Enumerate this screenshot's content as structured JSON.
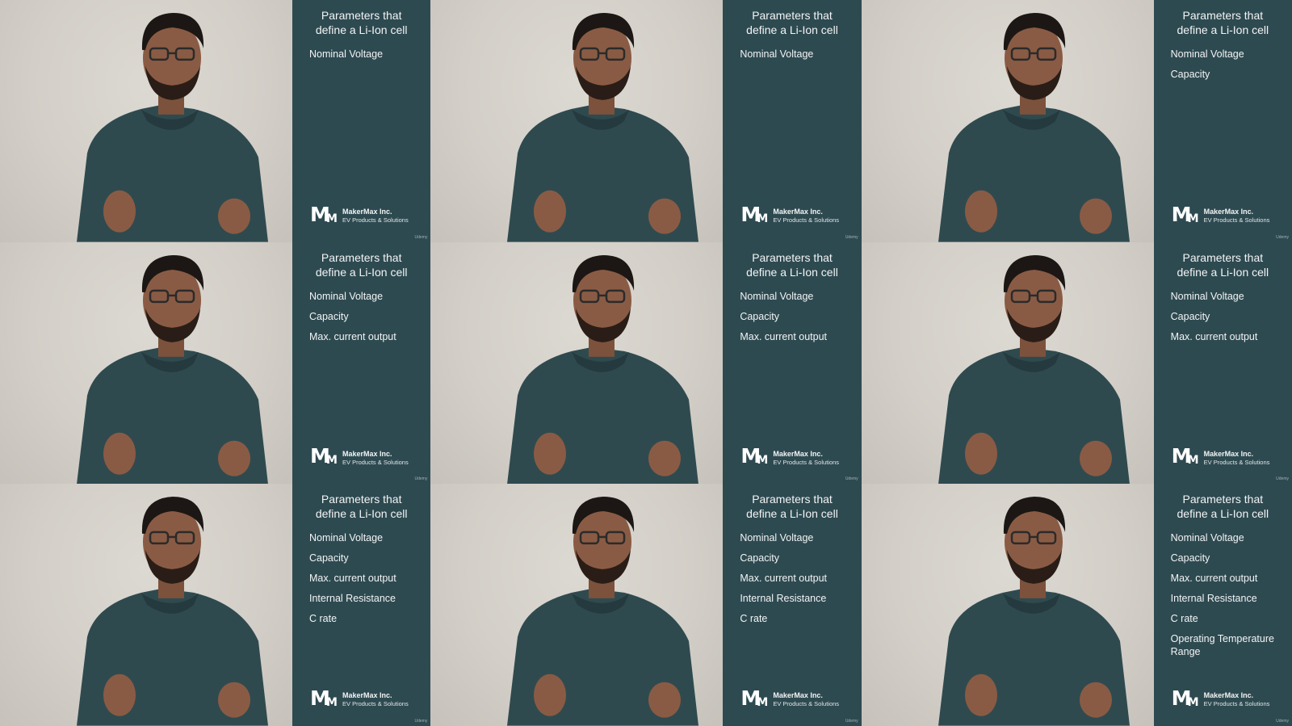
{
  "panel_title": "Parameters that\ndefine a Li-Ion cell",
  "brand": {
    "mark_big": "M",
    "mark_small": "M",
    "name": "MakerMax Inc.",
    "tagline": "EV Products & Solutions"
  },
  "watermark": "Udemy",
  "colors": {
    "panel": "#2e4a51",
    "wall": "#d6d2cb",
    "sweater": "#2f4a4f",
    "skin": "#8a5b44",
    "hair": "#1c1714"
  },
  "frames": [
    {
      "params": [
        "Nominal Voltage"
      ]
    },
    {
      "params": [
        "Nominal Voltage"
      ]
    },
    {
      "params": [
        "Nominal Voltage",
        "Capacity"
      ]
    },
    {
      "params": [
        "Nominal Voltage",
        "Capacity",
        "Max. current output"
      ]
    },
    {
      "params": [
        "Nominal Voltage",
        "Capacity",
        "Max. current output"
      ]
    },
    {
      "params": [
        "Nominal Voltage",
        "Capacity",
        "Max. current output"
      ]
    },
    {
      "params": [
        "Nominal Voltage",
        "Capacity",
        "Max. current output",
        "Internal Resistance",
        "C rate"
      ]
    },
    {
      "params": [
        "Nominal Voltage",
        "Capacity",
        "Max. current output",
        "Internal Resistance",
        "C rate"
      ]
    },
    {
      "params": [
        "Nominal Voltage",
        "Capacity",
        "Max. current output",
        "Internal Resistance",
        "C rate",
        "Operating Temperature Range"
      ]
    }
  ]
}
